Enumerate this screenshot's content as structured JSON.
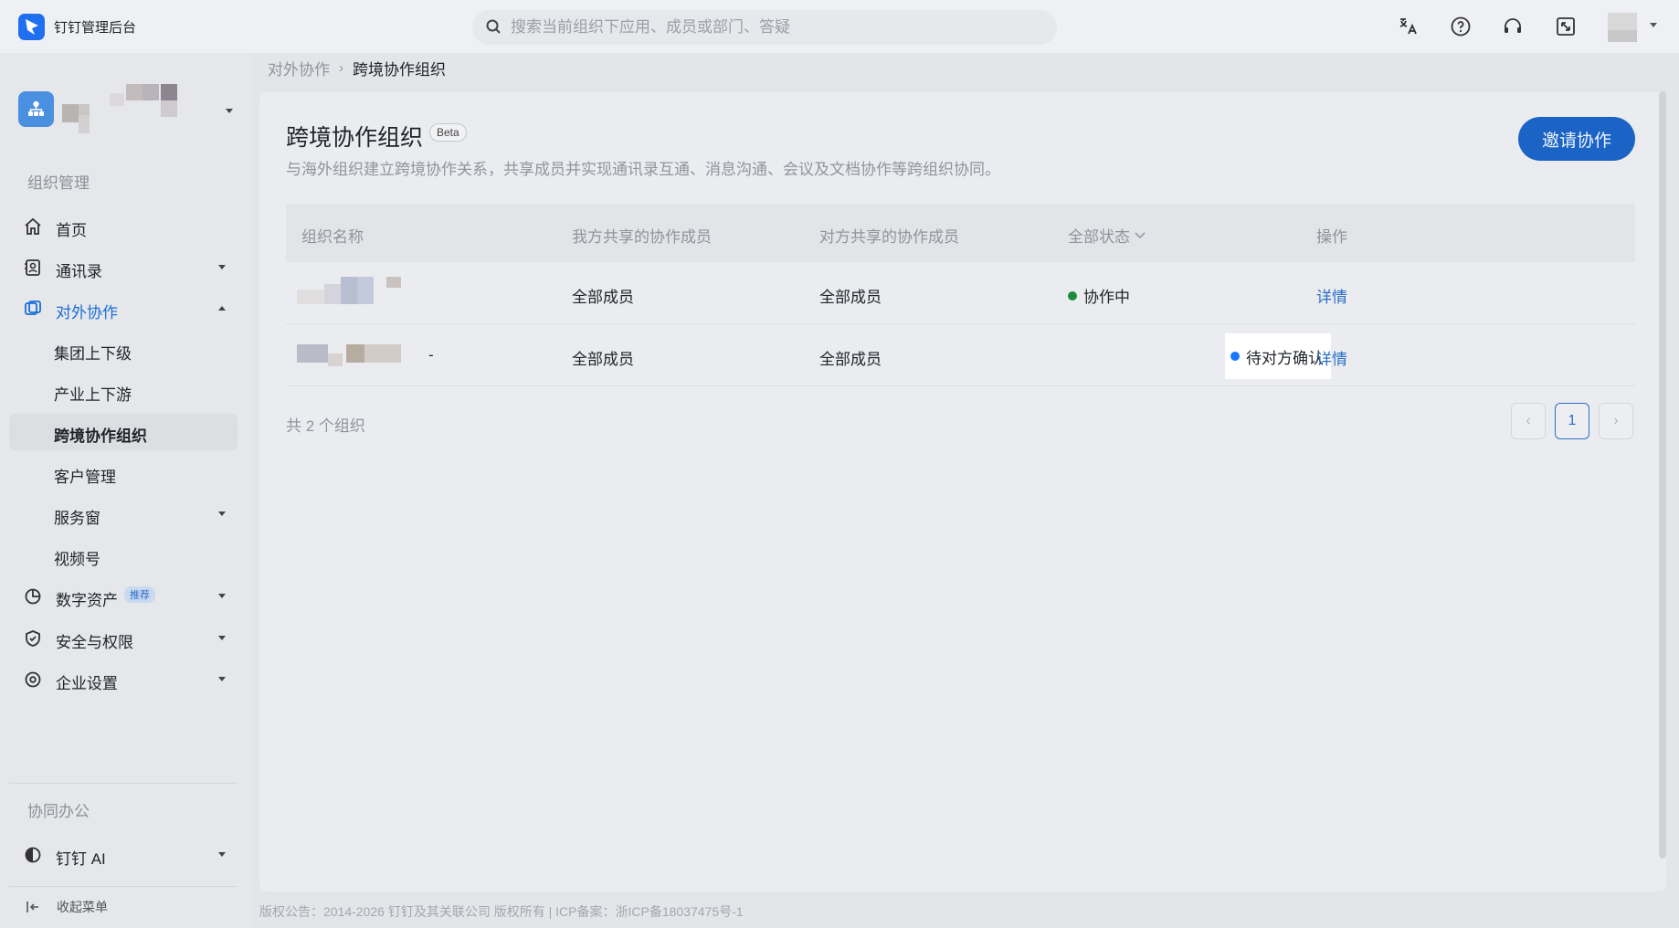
{
  "app": {
    "title": "钉钉管理后台",
    "accent_color": "#1a6fd8"
  },
  "search": {
    "placeholder": "搜索当前组织下应用、成员或部门、答疑"
  },
  "topbar_icons": [
    "translate-icon",
    "help-icon",
    "headset-icon",
    "fullscreen-icon"
  ],
  "sidebar": {
    "group_manage": "组织管理",
    "items": {
      "home": "首页",
      "contacts": "通讯录",
      "external": "对外协作",
      "group_up_down": "集团上下级",
      "industry_up_down": "产业上下游",
      "cross_border": "跨境协作组织",
      "customer": "客户管理",
      "service_window": "服务窗",
      "video": "视频号",
      "digital_assets": "数字资产",
      "digital_assets_badge": "推荐",
      "security": "安全与权限",
      "enterprise_settings": "企业设置"
    },
    "group_collab": "协同办公",
    "ai": "钉钉 AI",
    "collapse": "收起菜单"
  },
  "breadcrumb": {
    "parent": "对外协作",
    "current": "跨境协作组织"
  },
  "page": {
    "title": "跨境协作组织",
    "badge": "Beta",
    "description": "与海外组织建立跨境协作关系，共享成员并实现通讯录互通、消息沟通、会议及文档协作等跨组织协同。",
    "invite_button": "邀请协作"
  },
  "table": {
    "columns": {
      "name": "组织名称",
      "my_shared": "我方共享的协作成员",
      "their_shared": "对方共享的协作成员",
      "status": "全部状态",
      "action": "操作"
    },
    "rows": [
      {
        "name_suffix": "",
        "my_shared": "全部成员",
        "their_shared": "全部成员",
        "status": "协作中",
        "status_color": "#1e8a3c",
        "action": "详情"
      },
      {
        "name_suffix": "-",
        "my_shared": "全部成员",
        "their_shared": "全部成员",
        "status": "待对方确认",
        "status_color": "#1677ff",
        "action": "详情"
      }
    ]
  },
  "pagination": {
    "total_text": "共 2 个组织",
    "current_page": "1",
    "prev": "‹",
    "next": "›"
  },
  "footer": {
    "text": "版权公告：2014-2026 钉钉及其关联公司 版权所有 | ICP备案：浙ICP备18037475号-1"
  }
}
